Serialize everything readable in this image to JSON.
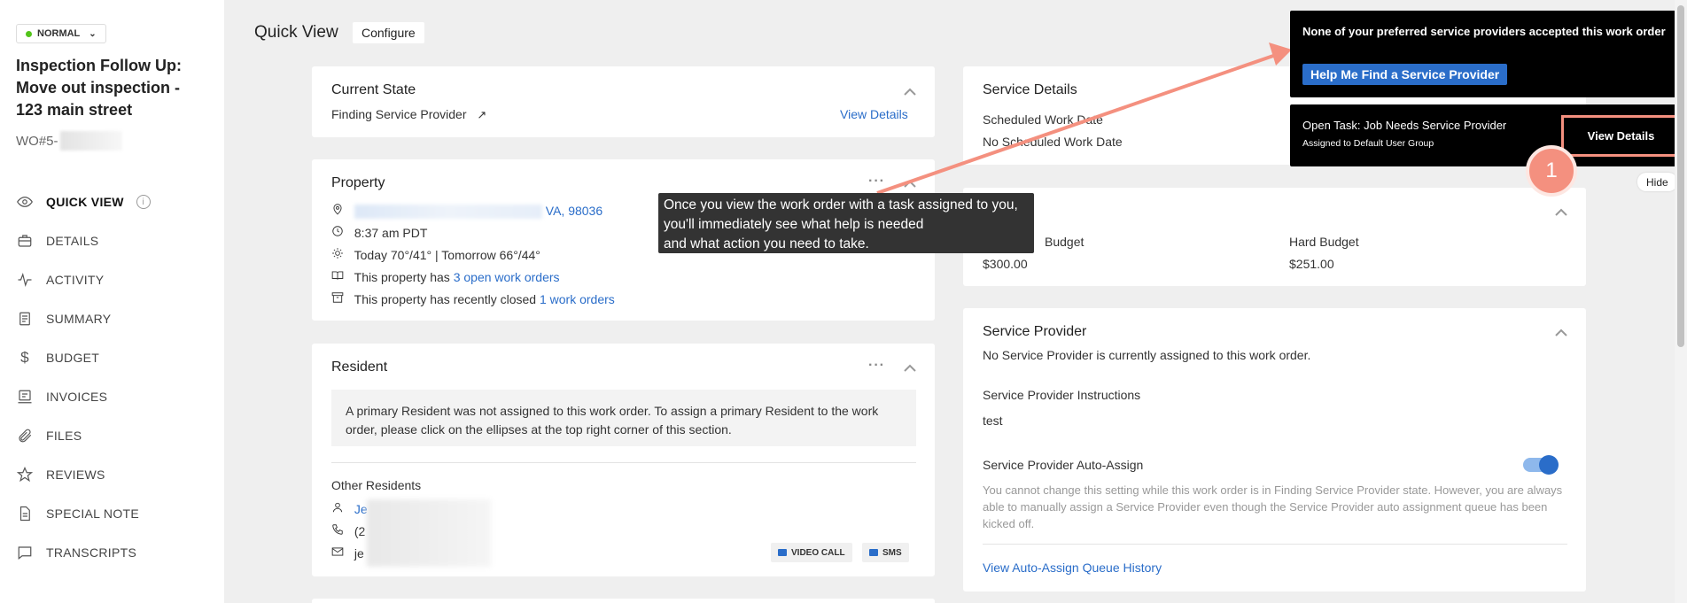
{
  "sidebar": {
    "status": "NORMAL",
    "title": "Inspection Follow Up: Move out inspection - 123 main street",
    "wo_prefix": "WO#5-",
    "nav": [
      {
        "label": "QUICK VIEW",
        "icon": "eye-icon"
      },
      {
        "label": "DETAILS",
        "icon": "briefcase-icon"
      },
      {
        "label": "ACTIVITY",
        "icon": "activity-icon"
      },
      {
        "label": "SUMMARY",
        "icon": "document-icon"
      },
      {
        "label": "BUDGET",
        "icon": "dollar-icon"
      },
      {
        "label": "INVOICES",
        "icon": "invoice-icon"
      },
      {
        "label": "FILES",
        "icon": "paperclip-icon"
      },
      {
        "label": "REVIEWS",
        "icon": "star-icon"
      },
      {
        "label": "SPECIAL NOTE",
        "icon": "note-icon"
      },
      {
        "label": "TRANSCRIPTS",
        "icon": "chat-icon"
      }
    ]
  },
  "header": {
    "title": "Quick View",
    "configure": "Configure"
  },
  "current_state": {
    "title": "Current State",
    "value": "Finding Service Provider",
    "link": "View Details"
  },
  "property": {
    "title": "Property",
    "address_tail": "VA, 98036",
    "time": "8:37 am PDT",
    "weather": "Today 70°/41° | Tomorrow 66°/44°",
    "open_prefix": "This property has ",
    "open_link": "3 open work orders",
    "closed_prefix": "This property has recently closed ",
    "closed_link": "1 work orders"
  },
  "resident": {
    "title": "Resident",
    "notice": "A primary Resident was not assigned to this work order. To assign a primary Resident to the work order, please click on the ellipses at the top right corner of this section.",
    "other_title": "Other Residents",
    "name_start": "Je",
    "phone_start": "(2",
    "email_start": "je",
    "video_call": "VIDEO CALL",
    "sms": "SMS"
  },
  "service_details": {
    "title": "Service Details",
    "scheduled_label": "Scheduled Work Date",
    "scheduled_value": "No Scheduled Work Date"
  },
  "budget": {
    "soft_label": "Budget",
    "soft_value": "$300.00",
    "hard_label": "Hard Budget",
    "hard_value": "$251.00"
  },
  "service_provider": {
    "title": "Service Provider",
    "none": "No Service Provider is currently assigned to this work order.",
    "instructions_label": "Service Provider Instructions",
    "instructions_value": "test",
    "auto_assign_label": "Service Provider Auto-Assign",
    "auto_assign_note": "You cannot change this setting while this work order is in Finding Service Provider state. However, you are always able to manually assign a Service Provider even though the Service Provider auto assignment queue has been kicked off.",
    "queue_link": "View Auto-Assign Queue History"
  },
  "tooltip": {
    "line1": "Once you view the work order with a task assigned to you,",
    "line2": "you'll immediately see what help is needed",
    "line3": "and what action you need to take."
  },
  "notification": {
    "message": "None of your preferred service providers accepted this work order",
    "help_button": "Help Me Find a Service Provider",
    "task_title": "Open Task: Job Needs Service Provider",
    "task_assigned": "Assigned to Default User Group",
    "view_details": "View Details",
    "badge": "1",
    "hide": "Hide"
  },
  "colors": {
    "accent": "#2a6dc9",
    "highlight": "#f4907f",
    "status": "#52c41a"
  }
}
